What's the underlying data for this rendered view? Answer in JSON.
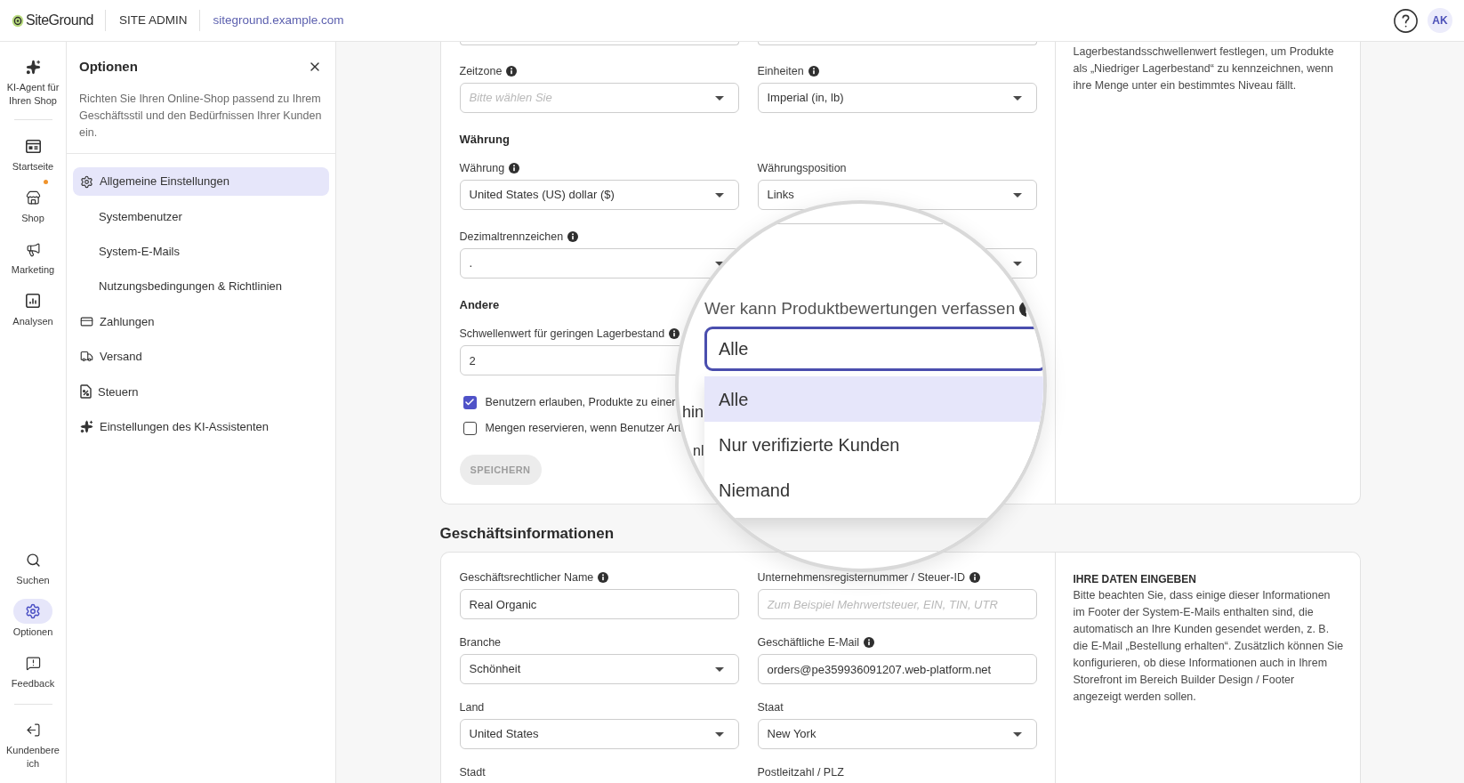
{
  "header": {
    "logo": "SiteGround",
    "section": "SITE ADMIN",
    "site_link": "siteground.example.com",
    "avatar": "AK"
  },
  "rail": {
    "top": [
      {
        "label": "KI-Agent für Ihren Shop",
        "selected": false,
        "notification": false
      },
      {
        "label": "Startseite",
        "selected": false,
        "notification": false
      },
      {
        "label": "Shop",
        "selected": false,
        "notification": true
      },
      {
        "label": "Marketing",
        "selected": false,
        "notification": false
      },
      {
        "label": "Analysen",
        "selected": false,
        "notification": false
      }
    ],
    "bottom": [
      {
        "label": "Suchen",
        "selected": false,
        "notification": false
      },
      {
        "label": "Optionen",
        "selected": true,
        "notification": false
      },
      {
        "label": "Feedback",
        "selected": false,
        "notification": false
      },
      {
        "label": "Kundenbereich",
        "selected": false,
        "notification": false
      }
    ]
  },
  "options_panel": {
    "title": "Optionen",
    "description": "Richten Sie Ihren Online-Shop passend zu Ihrem Geschäftsstil und den Bedürfnissen Ihrer Kunden ein.",
    "items": [
      {
        "kind": "section",
        "label": "Allgemeine Einstellungen",
        "selected": true
      },
      {
        "kind": "sub",
        "label": "Systembenutzer",
        "selected": false
      },
      {
        "kind": "sub",
        "label": "System-E-Mails",
        "selected": false
      },
      {
        "kind": "sub",
        "label": "Nutzungsbedingungen & Richtlinien",
        "selected": false
      },
      {
        "kind": "section",
        "label": "Zahlungen",
        "selected": false
      },
      {
        "kind": "section",
        "label": "Versand",
        "selected": false
      },
      {
        "kind": "section",
        "label": "Steuern",
        "selected": false
      },
      {
        "kind": "section",
        "label": "Einstellungen des KI-Assistenten",
        "selected": false
      }
    ]
  },
  "general_settings": {
    "rows": [
      {
        "kind": "fields",
        "fields": [
          {
            "label": "Zeitzone",
            "info": true,
            "kind": "select",
            "placeholder": "Bitte wählen Sie"
          },
          {
            "label": "Einheiten",
            "info": true,
            "kind": "select",
            "value": "Imperial (in, lb)"
          }
        ]
      },
      {
        "kind": "heading",
        "text": "Währung"
      },
      {
        "kind": "fields",
        "fields": [
          {
            "label": "Währung",
            "info": true,
            "kind": "select",
            "value": "United States (US) dollar ($)"
          },
          {
            "label": "Währungsposition",
            "info": false,
            "kind": "select",
            "value": "Links"
          }
        ]
      },
      {
        "kind": "fields",
        "fields": [
          {
            "label": "Dezimaltrennzeichen",
            "info": true,
            "kind": "select",
            "value": "."
          },
          {
            "kind": "select"
          }
        ]
      },
      {
        "kind": "heading",
        "text": "Andere"
      },
      {
        "kind": "fields",
        "fields": [
          {
            "label": "Schwellenwert für geringen Lagerbestand",
            "info": true,
            "kind": "input",
            "value": "2"
          }
        ]
      },
      {
        "kind": "checkbox",
        "label": "Benutzern erlauben, Produkte zu einer",
        "checked": true
      },
      {
        "kind": "checkbox",
        "label": "Mengen reservieren, wenn Benutzer Art",
        "checked": false
      },
      {
        "kind": "button",
        "label": "SPEICHERN",
        "disabled": true
      }
    ],
    "help_text": "Lagerbestandsschwellenwert festlegen, um Produkte als „Niedriger Lagerbestand“ zu kennzeichnen, wenn ihre Menge unter ein bestimmtes Niveau fällt."
  },
  "magnifier": {
    "background_text": [
      "hin",
      "nl"
    ],
    "label": "Wer kann Produktbewertungen verfassen",
    "info": true,
    "value": "Alle",
    "options": [
      {
        "label": "Alle",
        "selected": true
      },
      {
        "label": "Nur verifizierte Kunden",
        "selected": false
      },
      {
        "label": "Niemand",
        "selected": false
      }
    ]
  },
  "business_info": {
    "title": "Geschäftsinformationen",
    "fields": [
      {
        "label": "Geschäftsrechtlicher Name",
        "info": true,
        "kind": "input",
        "value": "Real Organic"
      },
      {
        "label": "Unternehmensregisternummer / Steuer-ID",
        "info": true,
        "kind": "input",
        "placeholder": "Zum Beispiel Mehrwertsteuer, EIN, TIN, UTR"
      },
      {
        "label": "Branche",
        "info": false,
        "kind": "select",
        "value": "Schönheit"
      },
      {
        "label": "Geschäftliche E-Mail",
        "info": true,
        "kind": "input",
        "value": "orders@pe359936091207.web-platform.net"
      },
      {
        "label": "Land",
        "info": false,
        "kind": "select",
        "value": "United States"
      },
      {
        "label": "Staat",
        "info": false,
        "kind": "select",
        "value": "New York"
      },
      {
        "label": "Stadt",
        "info": false,
        "kind": "label_only"
      },
      {
        "label": "Postleitzahl / PLZ",
        "info": false,
        "kind": "label_only"
      }
    ],
    "help_title": "IHRE DATEN EINGEBEN",
    "help_text": "Bitte beachten Sie, dass einige dieser Informationen im Footer der System-E-Mails enthalten sind, die automatisch an Ihre Kunden gesendet werden, z. B. die E-Mail „Bestellung erhalten“. Zusätzlich können Sie konfigurieren, ob diese Informationen auch in Ihrem Storefront im Bereich Builder Design / Footer angezeigt werden sollen."
  }
}
